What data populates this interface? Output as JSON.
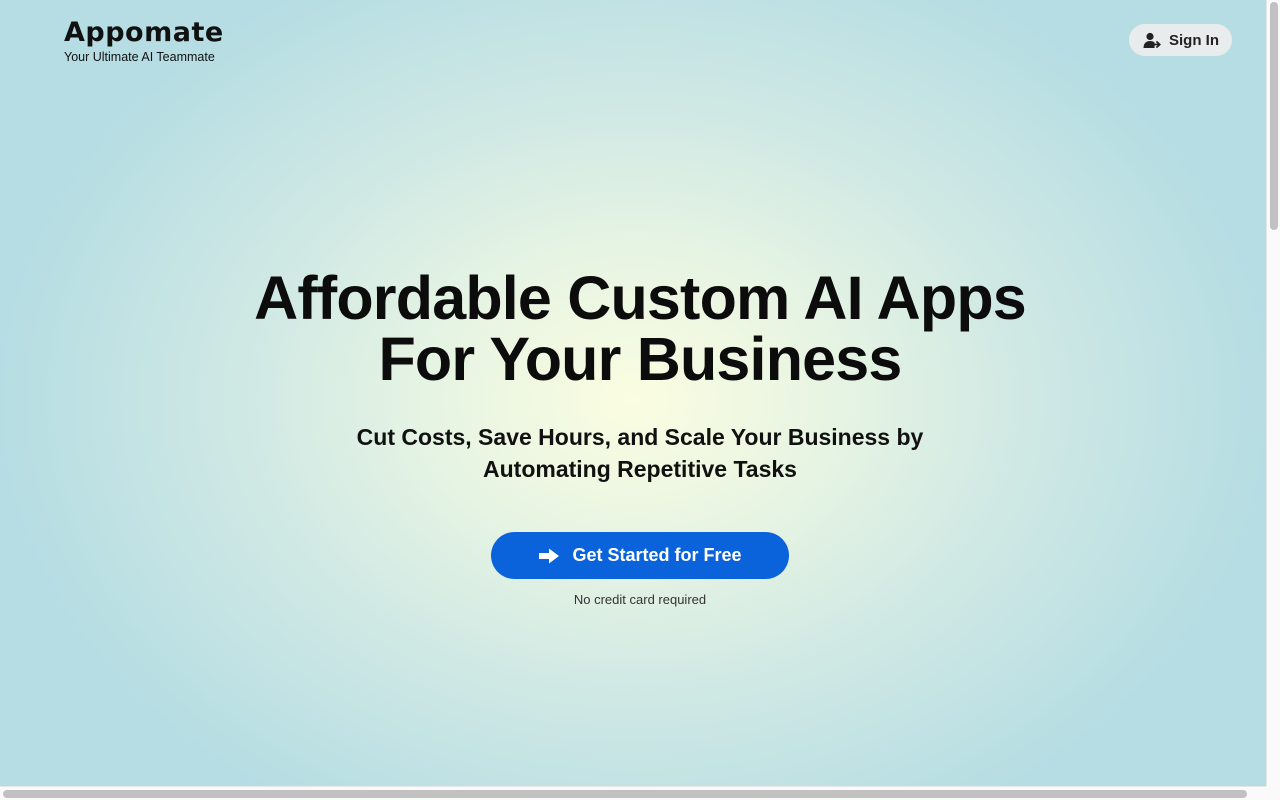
{
  "brand": {
    "name": "Appomate",
    "tagline": "Your Ultimate AI Teammate"
  },
  "header": {
    "signin_label": "Sign In",
    "signin_icon": "user-sign-in-icon"
  },
  "hero": {
    "title_line1": "Affordable Custom AI Apps",
    "title_line2": "For Your Business",
    "subtitle_line1": "Cut Costs, Save Hours, and Scale Your Business by",
    "subtitle_line2": "Automating Repetitive Tasks",
    "cta_label": "Get Started for Free",
    "cta_icon": "arrow-right-icon",
    "note": "No credit card required"
  },
  "colors": {
    "accent": "#0a63da",
    "text": "#0c0c0c",
    "background_center": "#fbfde1",
    "background_edge": "#b5dde3",
    "signin_bg": "#e9ecec"
  }
}
